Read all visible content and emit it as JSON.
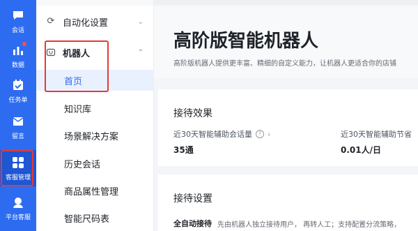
{
  "rail": {
    "items": [
      {
        "label": "会话",
        "icon": "chat-icon"
      },
      {
        "label": "数据",
        "icon": "bar-chart-icon"
      },
      {
        "label": "任务单",
        "icon": "task-icon"
      },
      {
        "label": "留言",
        "icon": "message-icon"
      },
      {
        "label": "客服管理",
        "icon": "grid-apps-icon"
      },
      {
        "label": "平台客服",
        "icon": "headset-icon"
      }
    ],
    "active_index": 4,
    "color": "#2d6cf0"
  },
  "nav": {
    "groups": [
      {
        "label": "自动化设置",
        "icon": "refresh-icon",
        "expanded": false
      },
      {
        "label": "机器人",
        "icon": "robot-icon",
        "expanded": true
      }
    ],
    "robot_items": [
      "首页",
      "知识库",
      "场景解决方案",
      "历史会话",
      "商品属性管理",
      "智能尺码表"
    ],
    "active_item": "首页"
  },
  "main": {
    "title": "高阶版智能机器人",
    "subtitle": "高阶版机器人提供更丰富、精细的自定义能力，让机器人更适合你的店铺",
    "reception_effect": {
      "title": "接待效果",
      "metrics": [
        {
          "label": "近30天智能辅助会话量",
          "value": "35通"
        },
        {
          "label": "近30天智能辅助节省",
          "value": "0.01人/日"
        }
      ]
    },
    "reception_settings": {
      "title": "接待设置",
      "mode_label": "全自动接待",
      "mode_desc": "先由机器人独立接待用户，  再转人工；支持配置分流策略，"
    }
  },
  "colors": {
    "accent": "#2d6cf0",
    "highlight_box": "#e53935",
    "active_bg": "#eaf1fe"
  }
}
